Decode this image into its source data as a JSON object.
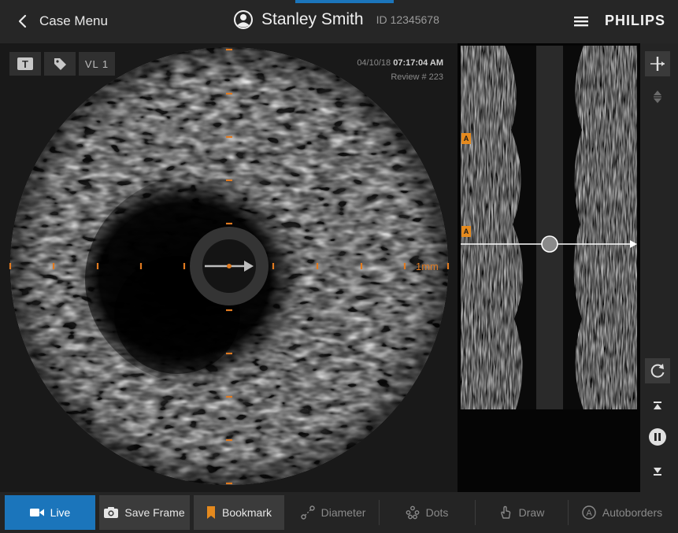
{
  "header": {
    "back_label": "Case Menu",
    "patient_name": "Stanley Smith",
    "id_label": "ID",
    "patient_id": "12345678",
    "brand": "PHILIPS"
  },
  "image": {
    "text_tool_glyph": "T",
    "vessel_label": "VL 1",
    "date": "04/10/18",
    "time": "07:17:04 AM",
    "review": "Review # 223",
    "scale_label": "1mm"
  },
  "longitudinal": {
    "bookmark_marker": "A"
  },
  "toolbar": {
    "live": "Live",
    "save_frame": "Save Frame",
    "bookmark": "Bookmark",
    "diameter": "Diameter",
    "dots": "Dots",
    "draw": "Draw",
    "autoborders": "Autoborders",
    "autoborders_glyph": "A"
  },
  "icons": [
    "chevron-left-icon",
    "user-avatar-icon",
    "hamburger-menu-icon",
    "text-tool-icon",
    "tag-icon",
    "slice-position-icon",
    "sort-icon",
    "rotate-icon",
    "skip-to-start-icon",
    "pause-icon",
    "skip-to-end-icon",
    "camera-icon",
    "save-frame-icon",
    "bookmark-icon",
    "diameter-icon",
    "dots-icon",
    "draw-hand-icon",
    "autoborders-icon"
  ],
  "colors": {
    "accent_blue": "#1b75bb",
    "marker_orange": "#e07a20",
    "bookmark_orange": "#e58a1e"
  }
}
